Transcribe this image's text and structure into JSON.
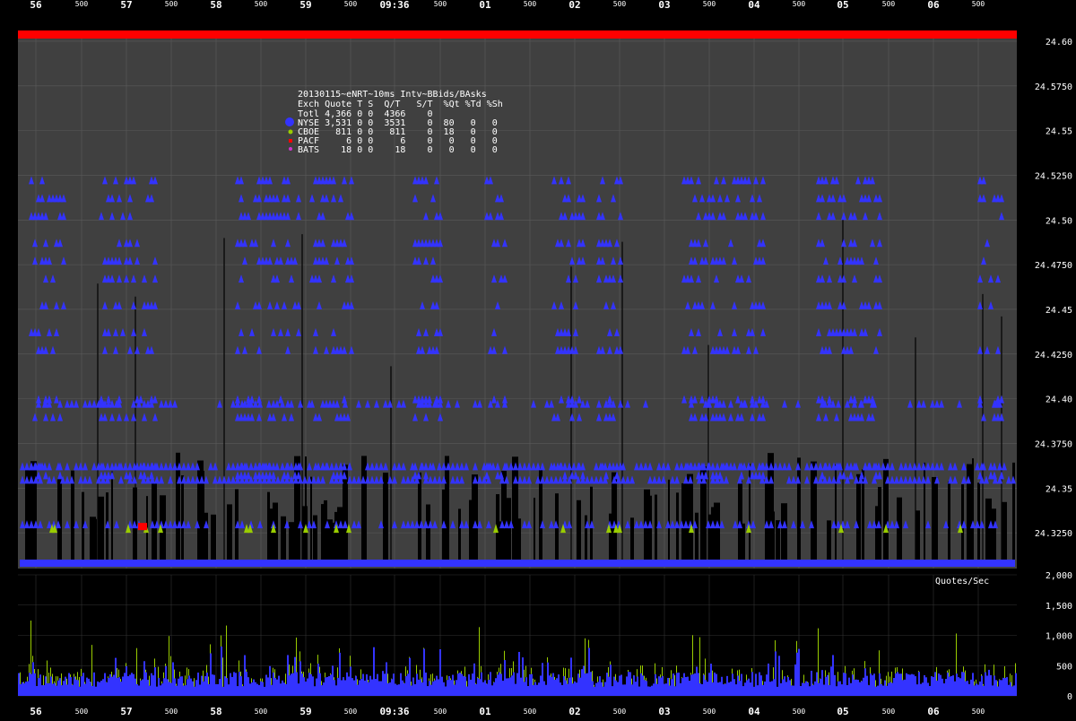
{
  "chart_data": [
    {
      "type": "scatter",
      "panel": "quotes",
      "title": "20130115~eNRT~10ms Intv~BBids/BAsks",
      "x_ticks_top": [
        "56",
        "500",
        "57",
        "500",
        "58",
        "500",
        "59",
        "500",
        "09:36",
        "500",
        "01",
        "500",
        "02",
        "500",
        "03",
        "500",
        "04",
        "500",
        "05",
        "500",
        "06",
        "500"
      ],
      "x_ticks_bottom": [
        "56",
        "500",
        "57",
        "500",
        "58",
        "500",
        "59",
        "500",
        "09:36",
        "500",
        "01",
        "500",
        "02",
        "500",
        "03",
        "500",
        "04",
        "500",
        "05",
        "500",
        "06",
        "500"
      ],
      "y_ticks": [
        "24.60",
        "24.5750",
        "24.55",
        "24.5250",
        "24.50",
        "24.4750",
        "24.45",
        "24.4250",
        "24.40",
        "24.3750",
        "24.35",
        "24.3250"
      ],
      "ylim": [
        24.305,
        24.605
      ],
      "grid": true,
      "legend": {
        "header": "Exch Quote T S  Q/T   S/T  %Qt %Td %Sh",
        "total": "Totl 4,366 0 0  4366    0",
        "rows": [
          {
            "text": "NYSE 3,531 0 0  3531    0  80   0   0",
            "color": "#3333ff"
          },
          {
            "text": "CBOE   811 0 0   811    0  18   0   0",
            "color": "#99cc00"
          },
          {
            "text": "PACF     6 0 0     6    0   0   0   0",
            "color": "#ff0000"
          },
          {
            "text": "BATS    18 0 0    18    0   0   0   0",
            "color": "#cc33cc"
          }
        ]
      },
      "series": [
        {
          "name": "NYSE",
          "color": "#3333ff",
          "count": 3531
        },
        {
          "name": "CBOE",
          "color": "#99cc00",
          "count": 811
        },
        {
          "name": "PACF",
          "color": "#ff0000",
          "count": 6
        },
        {
          "name": "BATS",
          "color": "#cc33cc",
          "count": 18
        }
      ],
      "nbbo_band": {
        "ask_top": 24.6,
        "bid_bottom": 24.32
      }
    },
    {
      "type": "bar",
      "panel": "rate",
      "ylabel": "Quotes/Sec",
      "y_ticks": [
        "2,000",
        "1,500",
        "1,000",
        "500",
        "0"
      ],
      "ylim": [
        0,
        2000
      ]
    }
  ],
  "colors": {
    "background": "#000000",
    "plot_bg": "#404040",
    "grid": "#5a5a5a",
    "nbbo_ask": "#ff0000",
    "nyse": "#3333ff",
    "cboe": "#99cc00",
    "pacf": "#ff0000",
    "bats": "#cc33cc"
  }
}
